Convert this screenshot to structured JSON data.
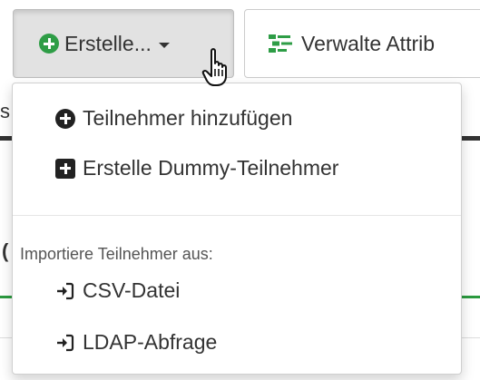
{
  "toolbar": {
    "create_label": "Erstelle...",
    "manage_label": "Verwalte Attrib"
  },
  "background": {
    "fragment_left_1": "s",
    "fragment_left_2": "("
  },
  "dropdown": {
    "items": [
      {
        "label": "Teilnehmer hinzufügen",
        "icon": "plus-circle-icon"
      },
      {
        "label": "Erstelle Dummy-Teilnehmer",
        "icon": "plus-square-icon"
      }
    ],
    "import_header": "Importiere Teilnehmer aus:",
    "import_items": [
      {
        "label": "CSV-Datei",
        "icon": "sign-in-icon"
      },
      {
        "label": "LDAP-Abfrage",
        "icon": "sign-in-icon"
      }
    ]
  },
  "colors": {
    "accent_green": "#2e9d46",
    "text": "#333333",
    "button_active_bg": "#e2e2e2"
  }
}
